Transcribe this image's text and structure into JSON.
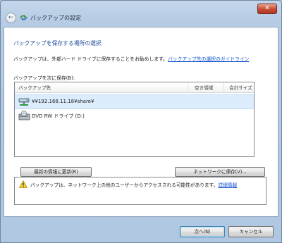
{
  "window": {
    "title": "バックアップの設定",
    "close_glyph": "✕"
  },
  "nav": {
    "back_glyph": "←"
  },
  "main": {
    "heading": "バックアップを保存する場所の選択",
    "description": "バックアップは、外部ハード ドライブに保存することをお勧めします。",
    "guide_link": "バックアップ先の選択のガイドライン",
    "list_label": "バックアップを次に保存(B):"
  },
  "table": {
    "columns": [
      "バックアップ先",
      "空き領域",
      "合計サイズ"
    ],
    "rows": [
      {
        "name": "¥¥192.168.11.18¥share¥",
        "icon": "network-drive-icon",
        "free": "",
        "total": "",
        "selected": true
      },
      {
        "name": "DVD RW ドライブ (D:)",
        "icon": "dvd-drive-icon",
        "free": "",
        "total": "",
        "selected": false
      }
    ]
  },
  "buttons": {
    "refresh": "最新の情報に更新(R)",
    "save_network": "ネットワークに保存(V)...",
    "next": "次へ(N)",
    "cancel": "キャンセル"
  },
  "notice": {
    "text": "バックアップは、ネットワーク上の他のユーザーからアクセスされる可能性があります。",
    "link": "詳細情報",
    "icon": "warning-icon"
  },
  "colors": {
    "heading": "#1e4a9b",
    "link": "#0b4fd0",
    "selection": "#dcecfc",
    "close": "#c74a33"
  }
}
